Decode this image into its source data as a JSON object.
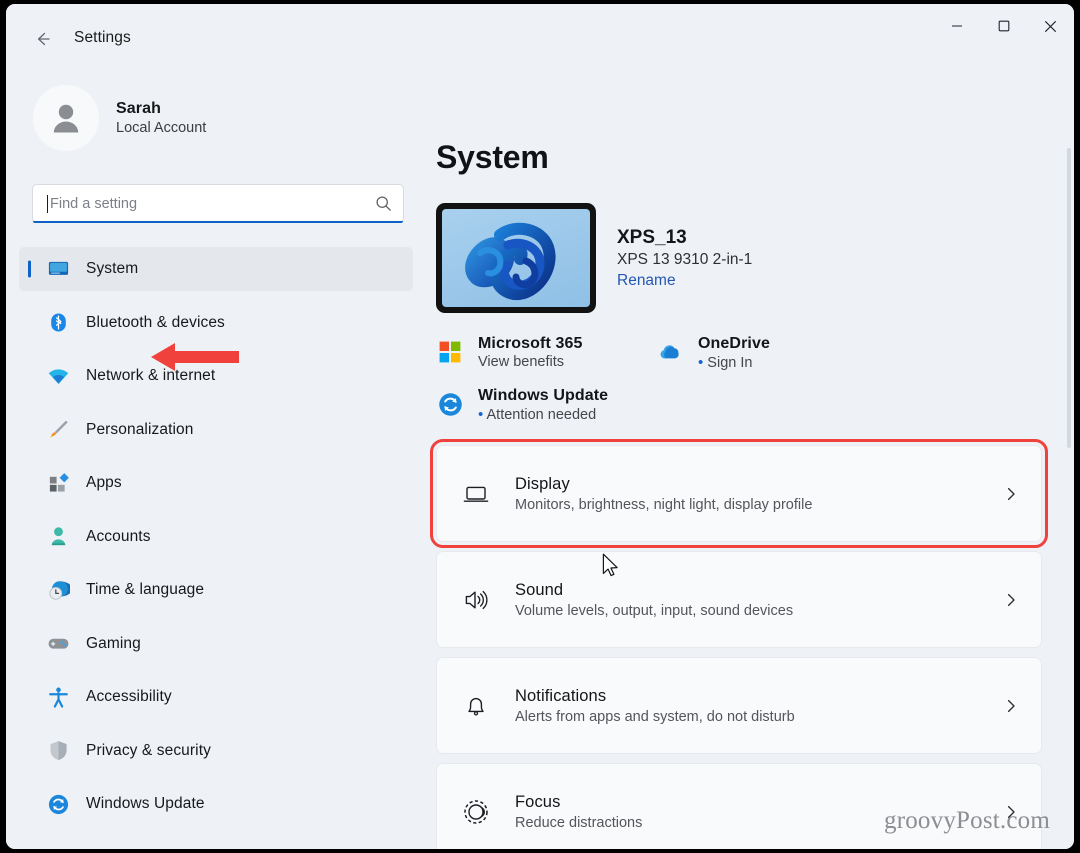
{
  "window": {
    "title": "Settings",
    "back_icon": "back-arrow-icon",
    "controls": {
      "minimize": "minimize-icon",
      "maximize": "maximize-icon",
      "close": "close-icon"
    }
  },
  "colors": {
    "accent": "#0e62c7",
    "annotation_red": "#f0413c",
    "sidebar_bg": "#eef2f7",
    "card_bg": "#f9fafc",
    "link_blue": "#2457b0"
  },
  "sidebar": {
    "account": {
      "name": "Sarah",
      "subtitle": "Local Account",
      "avatar_icon": "person-avatar-icon"
    },
    "search": {
      "placeholder": "Find a setting",
      "value": "",
      "icon": "search-icon"
    },
    "items": [
      {
        "label": "System",
        "icon": "system-monitor-icon",
        "selected": true
      },
      {
        "label": "Bluetooth & devices",
        "icon": "bluetooth-icon",
        "selected": false
      },
      {
        "label": "Network & internet",
        "icon": "wifi-icon",
        "selected": false
      },
      {
        "label": "Personalization",
        "icon": "paintbrush-icon",
        "selected": false
      },
      {
        "label": "Apps",
        "icon": "apps-icon",
        "selected": false
      },
      {
        "label": "Accounts",
        "icon": "accounts-person-icon",
        "selected": false
      },
      {
        "label": "Time & language",
        "icon": "clock-globe-icon",
        "selected": false
      },
      {
        "label": "Gaming",
        "icon": "gamepad-icon",
        "selected": false
      },
      {
        "label": "Accessibility",
        "icon": "accessibility-person-icon",
        "selected": false
      },
      {
        "label": "Privacy & security",
        "icon": "shield-icon",
        "selected": false
      },
      {
        "label": "Windows Update",
        "icon": "update-refresh-icon",
        "selected": false
      }
    ]
  },
  "main": {
    "page_title": "System",
    "device": {
      "name": "XPS_13",
      "model": "XPS 13 9310 2-in-1",
      "rename_label": "Rename",
      "thumbnail_icon": "windows-bloom-wallpaper-thumbnail"
    },
    "status": {
      "microsoft365": {
        "title": "Microsoft 365",
        "subtitle": "View benefits",
        "icon": "microsoft-logo-icon"
      },
      "onedrive": {
        "title": "OneDrive",
        "subtitle": "Sign In",
        "bullet": "•",
        "icon": "onedrive-cloud-icon"
      },
      "windows_update": {
        "title": "Windows Update",
        "subtitle": "Attention needed",
        "bullet": "•",
        "icon": "update-refresh-icon"
      }
    },
    "cards": [
      {
        "title": "Display",
        "subtitle": "Monitors, brightness, night light, display profile",
        "icon": "display-monitor-icon",
        "chevron": "chevron-right-icon",
        "highlighted": true
      },
      {
        "title": "Sound",
        "subtitle": "Volume levels, output, input, sound devices",
        "icon": "speaker-icon",
        "chevron": "chevron-right-icon",
        "highlighted": false
      },
      {
        "title": "Notifications",
        "subtitle": "Alerts from apps and system, do not disturb",
        "icon": "bell-icon",
        "chevron": "chevron-right-icon",
        "highlighted": false
      },
      {
        "title": "Focus",
        "subtitle": "Reduce distractions",
        "icon": "focus-moon-icon",
        "chevron": "chevron-right-icon",
        "highlighted": false
      }
    ]
  },
  "annotations": {
    "arrow_icon": "red-arrow-pointing-left",
    "cursor_icon": "mouse-pointer-icon"
  },
  "watermark": "groovyPost.com"
}
